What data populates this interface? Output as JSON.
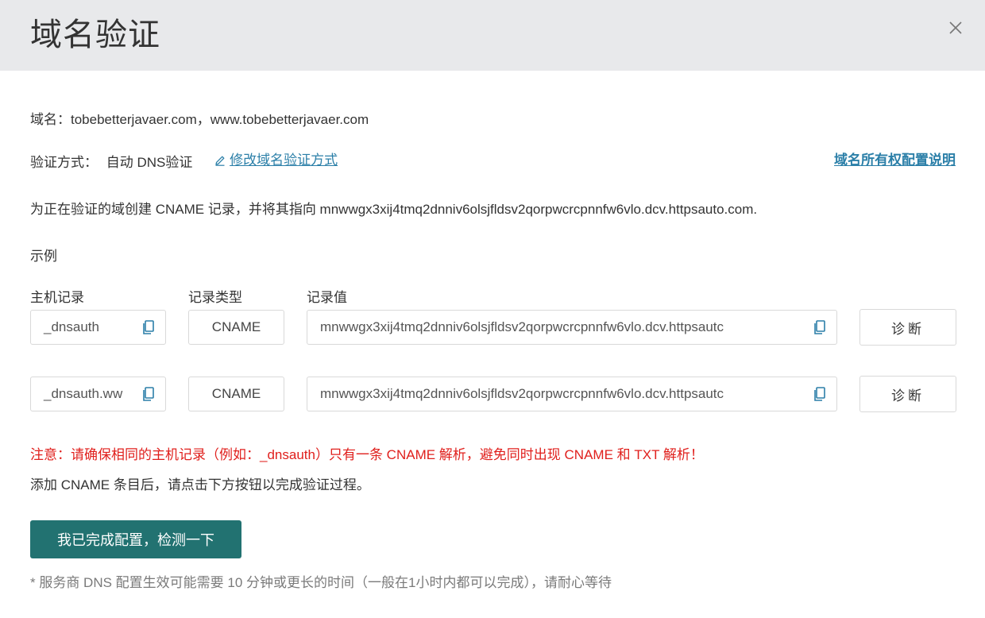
{
  "dialog": {
    "title": "域名验证"
  },
  "domain_line": "域名：tobebetterjavaer.com，www.tobebetterjavaer.com",
  "method": {
    "label": "验证方式：",
    "value": "自动 DNS验证",
    "modify_link": "修改域名验证方式",
    "ownership_link": "域名所有权配置说明"
  },
  "instruction": "为正在验证的域创建 CNAME 记录，并将其指向 mnwwgx3xij4tmq2dnniv6olsjfldsv2qorpwcrcpnnfw6vlo.dcv.httpsauto.com.",
  "example_label": "示例",
  "columns": {
    "host": "主机记录",
    "type": "记录类型",
    "value": "记录值"
  },
  "records": [
    {
      "host": "_dnsauth",
      "type": "CNAME",
      "value": "mnwwgx3xij4tmq2dnniv6olsjfldsv2qorpwcrcpnnfw6vlo.dcv.httpsautc",
      "diagnose": "诊断"
    },
    {
      "host": "_dnsauth.ww",
      "type": "CNAME",
      "value": "mnwwgx3xij4tmq2dnniv6olsjfldsv2qorpwcrcpnnfw6vlo.dcv.httpsautc",
      "diagnose": "诊断"
    }
  ],
  "warning": "注意：请确保相同的主机记录（例如：_dnsauth）只有一条 CNAME 解析，避免同时出现 CNAME 和 TXT 解析！",
  "after_text": "添加 CNAME 条目后，请点击下方按钮以完成验证过程。",
  "check_button": "我已完成配置，检测一下",
  "footnote": "* 服务商 DNS 配置生效可能需要 10 分钟或更长的时间（一般在1小时内都可以完成），请耐心等待",
  "icons": [
    "close-icon",
    "edit-icon",
    "copy-icon"
  ]
}
